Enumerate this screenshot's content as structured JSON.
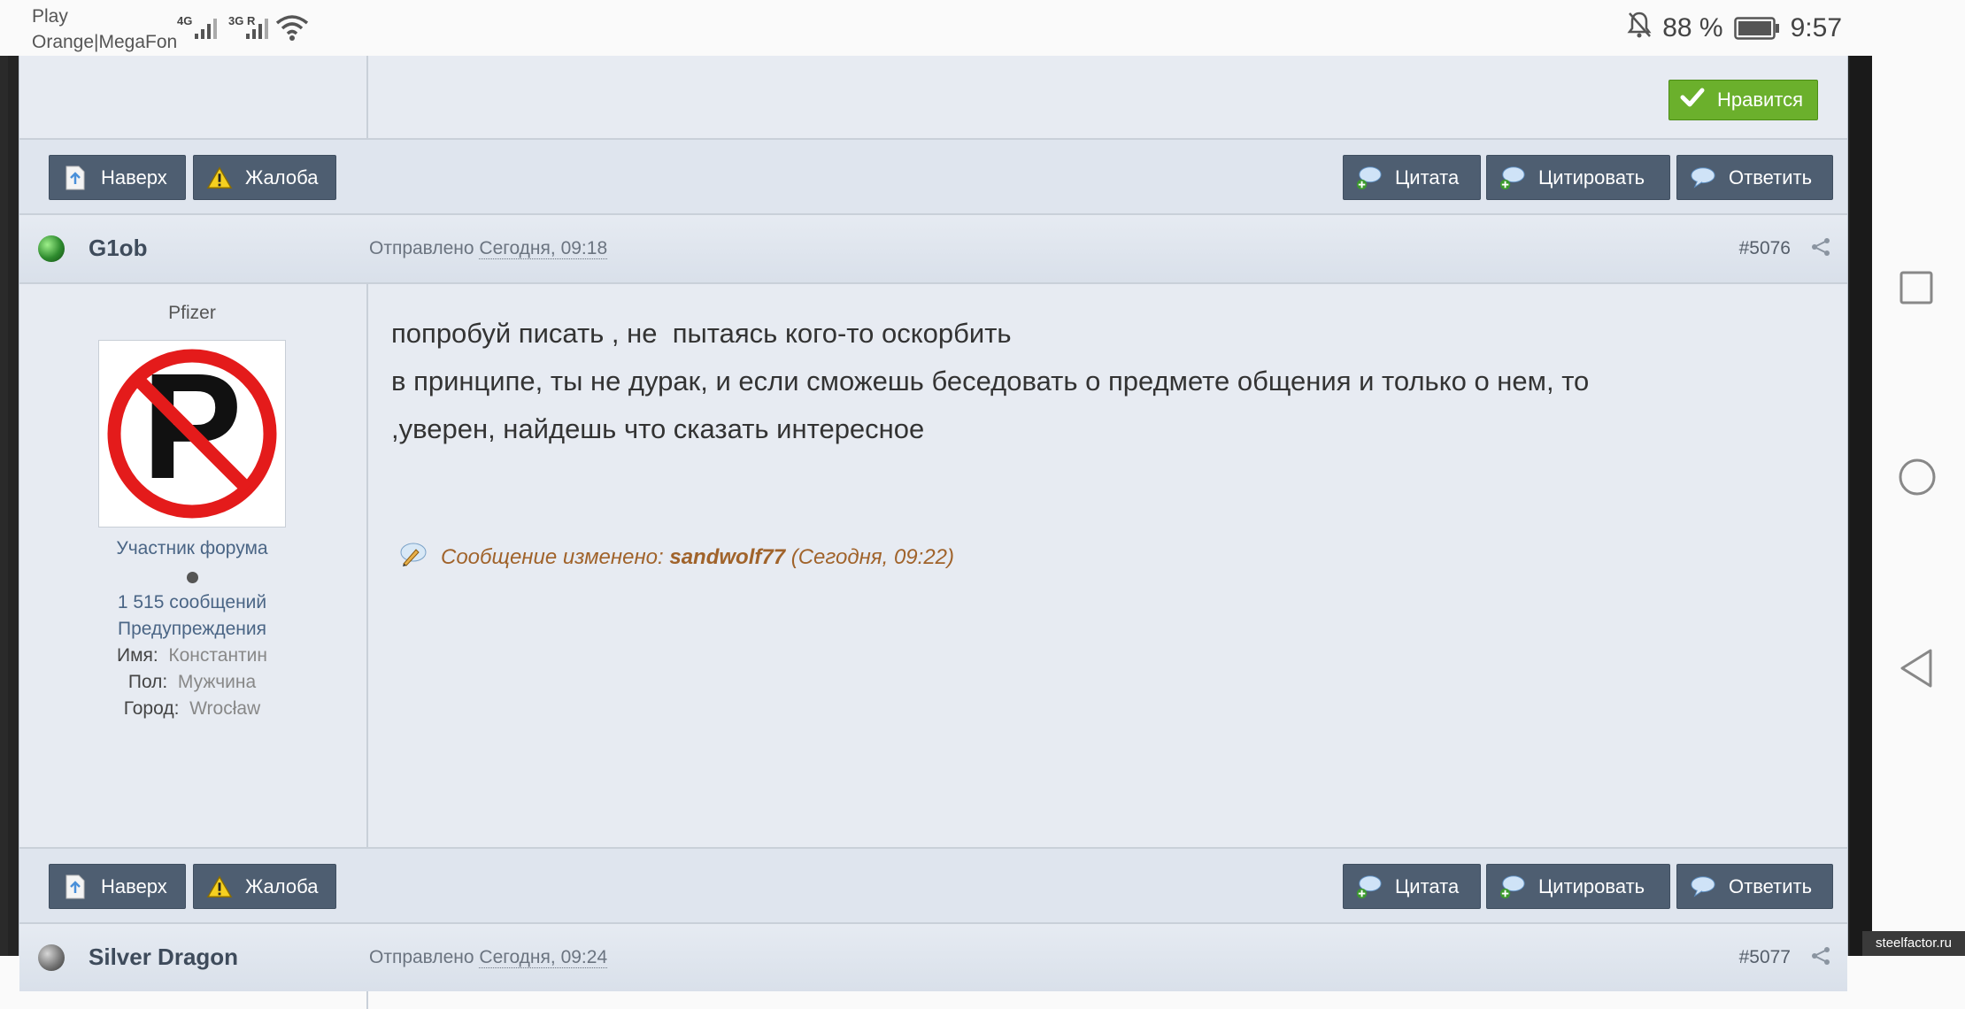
{
  "statusbar": {
    "carrier_line1": "Play",
    "carrier_line2": "Orange|MegaFon",
    "sig1_label": "4G",
    "sig2_label": "3G R",
    "battery": "88 %",
    "time": "9:57"
  },
  "like_button": "Нравится",
  "buttons": {
    "top": "Наверх",
    "report": "Жалоба",
    "quote": "Цитата",
    "cite": "Цитировать",
    "reply": "Ответить"
  },
  "post_5076": {
    "author": "G1ob",
    "sent_label": "Отправлено",
    "sent_date": "Сегодня, 09:18",
    "post_number": "#5076",
    "user_title": "Pfizer",
    "rank": "Участник форума",
    "posts_count": "1 515 сообщений",
    "warnings_link": "Предупреждения",
    "name_label": "Имя:",
    "name_value": "Константин",
    "gender_label": "Пол:",
    "gender_value": "Мужчина",
    "city_label": "Город:",
    "city_value": "Wrocław",
    "body_line1": "попробуй писать , не  пытаясь кого-то оскорбить",
    "body_line2": "в принципе, ты не дурак, и если сможешь беседовать о предмете общения и только о нем, то",
    "body_line3": ",уверен, найдешь что сказать интересное",
    "edited_prefix": "Сообщение изменено:",
    "edited_by": "sandwolf77",
    "edited_time": "(Сегодня, 09:22)"
  },
  "post_5077": {
    "author": "Silver Dragon",
    "sent_label": "Отправлено",
    "sent_date": "Сегодня, 09:24",
    "post_number": "#5077"
  },
  "watermark": "steelfactor.ru",
  "colors": {
    "button_bg": "#4e5e71",
    "like_bg": "#6bb02c",
    "edited_text": "#a0632b",
    "online_dot": "#2e8b2e"
  }
}
